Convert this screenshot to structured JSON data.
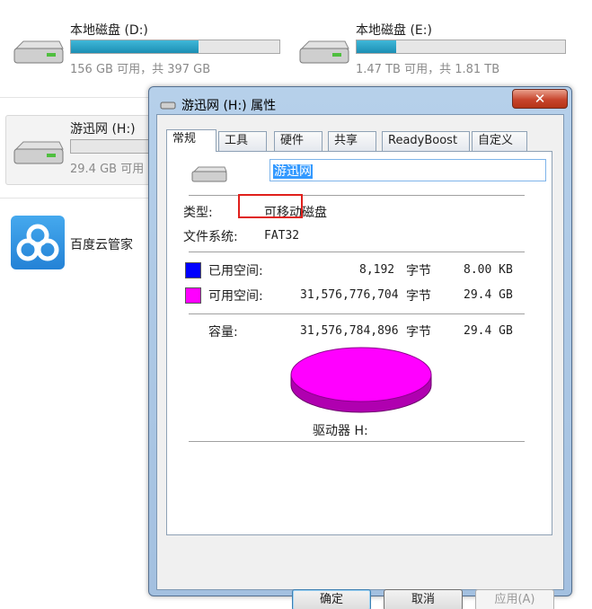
{
  "explorer": {
    "drives": [
      {
        "name": "本地磁盘 (D:)",
        "usage": "156 GB 可用，共 397 GB",
        "used_fraction": 0.61
      },
      {
        "name": "本地磁盘 (E:)",
        "usage": "1.47 TB 可用，共 1.81 TB",
        "used_fraction": 0.19
      },
      {
        "name": "游迅网 (H:)",
        "usage": "29.4 GB 可用",
        "used_fraction": 0.0
      }
    ],
    "app": {
      "name": "百度云管家",
      "icon": "baidu-cloud-icon"
    }
  },
  "dialog": {
    "title": "游迅网 (H:) 属性",
    "close_label": "✕",
    "tabs": [
      "常规",
      "工具",
      "硬件",
      "共享",
      "ReadyBoost",
      "自定义"
    ],
    "active_tab": "常规",
    "volume_label": "游迅网",
    "type_label": "类型:",
    "type_value": "可移动磁盘",
    "fs_label": "文件系统:",
    "fs_value": "FAT32",
    "used": {
      "label": "已用空间:",
      "bytes": "8,192",
      "unit": "字节",
      "size": "8.00 KB",
      "color": "#0000ff"
    },
    "free": {
      "label": "可用空间:",
      "bytes": "31,576,776,704",
      "unit": "字节",
      "size": "29.4 GB",
      "color": "#ff00ff"
    },
    "capacity": {
      "label": "容量:",
      "bytes": "31,576,784,896",
      "unit": "字节",
      "size": "29.4 GB"
    },
    "drive_caption": "驱动器 H:",
    "buttons": {
      "ok": "确定",
      "cancel": "取消",
      "apply": "应用(A)"
    }
  }
}
